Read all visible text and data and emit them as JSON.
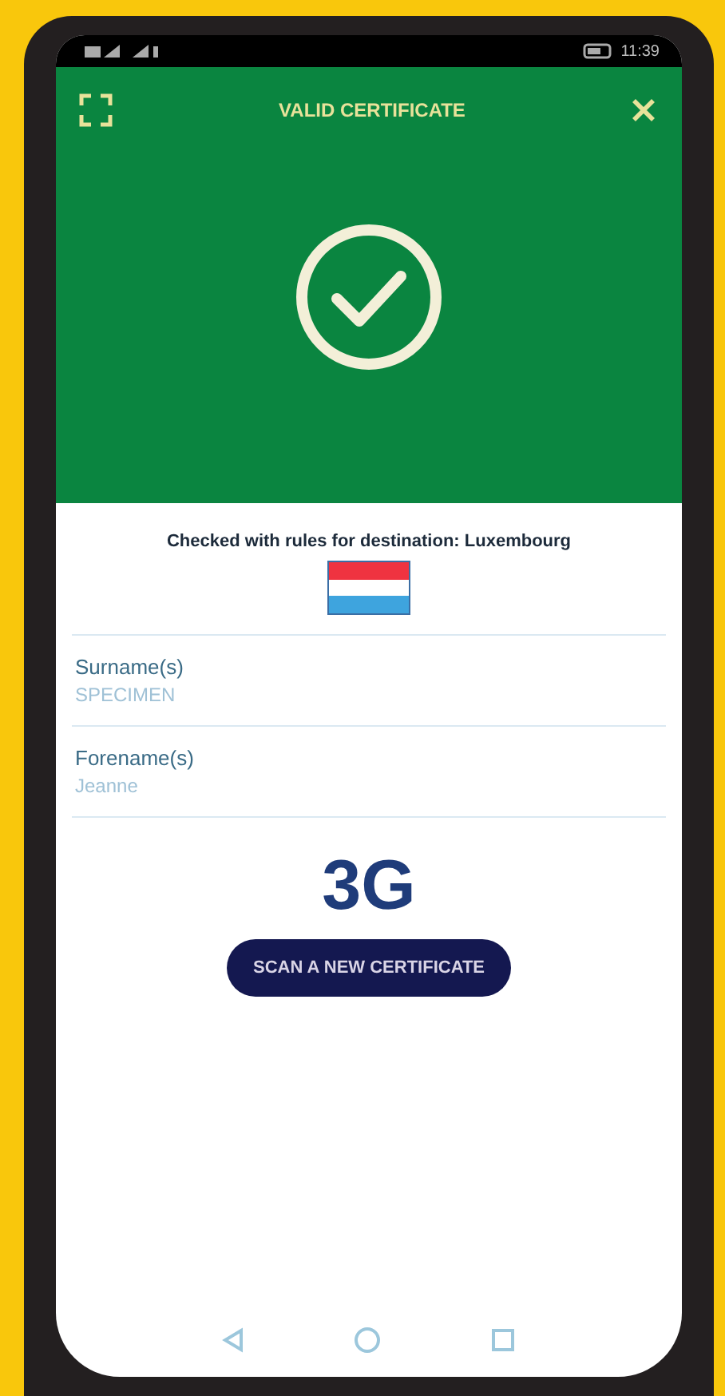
{
  "status_bar": {
    "time": "11:39"
  },
  "header": {
    "title": "VALID CERTIFICATE"
  },
  "destination": {
    "text": "Checked with rules for destination: Luxembourg"
  },
  "fields": [
    {
      "label": "Surname(s)",
      "value": "SPECIMEN"
    },
    {
      "label": "Forename(s)",
      "value": "Jeanne"
    }
  ],
  "certificate_type": "3G",
  "button": "SCAN A NEW CERTIFICATE"
}
